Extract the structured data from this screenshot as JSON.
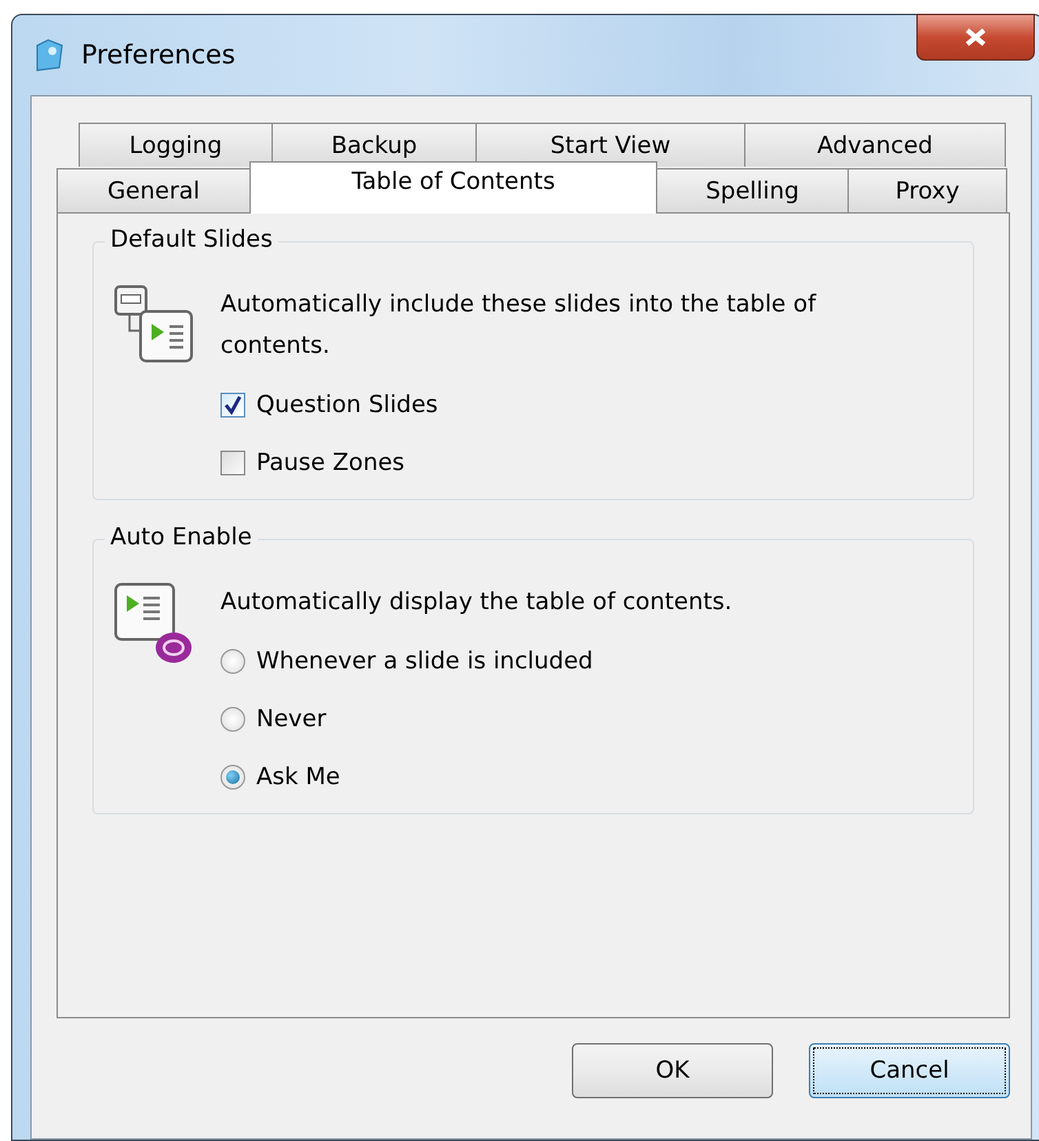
{
  "window": {
    "title": "Preferences"
  },
  "tab_rows": [
    [
      {
        "label": "Logging",
        "selected": false
      },
      {
        "label": "Backup",
        "selected": false
      },
      {
        "label": "Start View",
        "selected": false
      },
      {
        "label": "Advanced",
        "selected": false
      }
    ],
    [
      {
        "label": "General",
        "selected": false
      },
      {
        "label": "Table of Contents",
        "selected": true
      },
      {
        "label": "Spelling",
        "selected": false
      },
      {
        "label": "Proxy",
        "selected": false
      }
    ]
  ],
  "groups": [
    {
      "kind": "checkboxes",
      "title": "Default Slides",
      "description": "Automatically include these slides into the table of contents.",
      "options": [
        {
          "label": "Question Slides",
          "checked": true
        },
        {
          "label": "Pause Zones",
          "checked": false
        }
      ]
    },
    {
      "kind": "radios",
      "title": "Auto Enable",
      "description": "Automatically display the table of contents.",
      "options": [
        {
          "label": "Whenever a slide is included",
          "selected": false
        },
        {
          "label": "Never",
          "selected": false
        },
        {
          "label": "Ask Me",
          "selected": true
        }
      ]
    }
  ],
  "buttons": [
    {
      "label": "OK",
      "focused": false
    },
    {
      "label": "Cancel",
      "focused": true
    }
  ]
}
